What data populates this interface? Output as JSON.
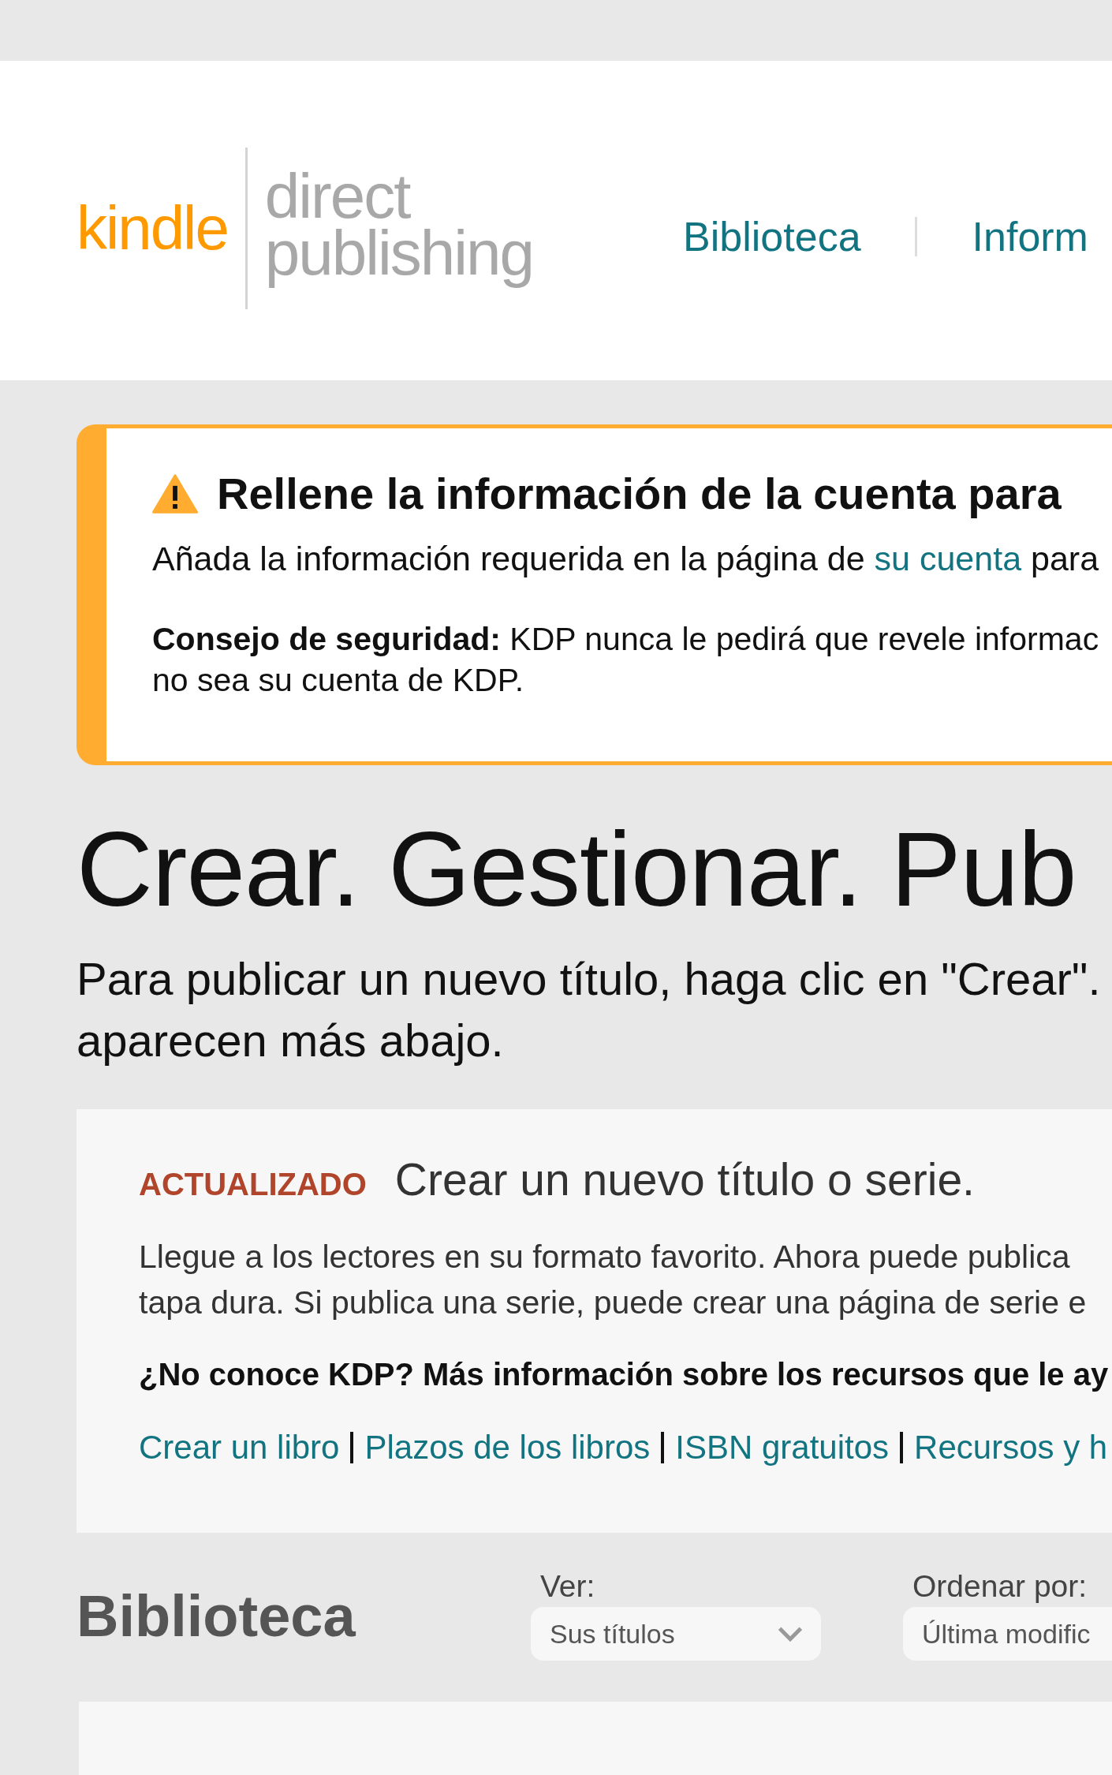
{
  "header": {
    "logo": {
      "brand": "kindle",
      "line1": "direct",
      "line2": "publishing"
    },
    "nav": [
      {
        "label": "Biblioteca"
      },
      {
        "label": "Inform"
      }
    ]
  },
  "alert": {
    "title": "Rellene la información de la cuenta para",
    "message": {
      "before": "Añada la información requerida en la página de ",
      "link": "su cuenta",
      "after": " para"
    },
    "tip_lines": [
      "**Consejo de seguridad:** KDP nunca le pedirá que revele informac",
      "no sea su cuenta de KDP."
    ]
  },
  "hero": {
    "title": "Crear. Gestionar. Pub",
    "lines": [
      "Para publicar un nuevo título, haga clic en \"Crear\".",
      "aparecen más abajo."
    ]
  },
  "promo": {
    "badge": "ACTUALIZADO",
    "title": "Crear un nuevo título o serie.",
    "lines": [
      "Llegue a los lectores en su formato favorito. Ahora puede publica",
      "tapa dura. Si publica una serie, puede crear una página de serie e"
    ],
    "help": "¿No conoce KDP? Más información sobre los recursos que le ay",
    "links": [
      {
        "label": "Crear un libro"
      },
      {
        "label": "Plazos de los libros"
      },
      {
        "label": "ISBN gratuitos"
      },
      {
        "label": "Recursos y h"
      }
    ]
  },
  "library": {
    "title": "Biblioteca",
    "filters": [
      {
        "label": "Ver:",
        "value": "Sus títulos",
        "chevron": true
      },
      {
        "label": "Ordenar por:",
        "value": "Última modific"
      }
    ]
  }
}
